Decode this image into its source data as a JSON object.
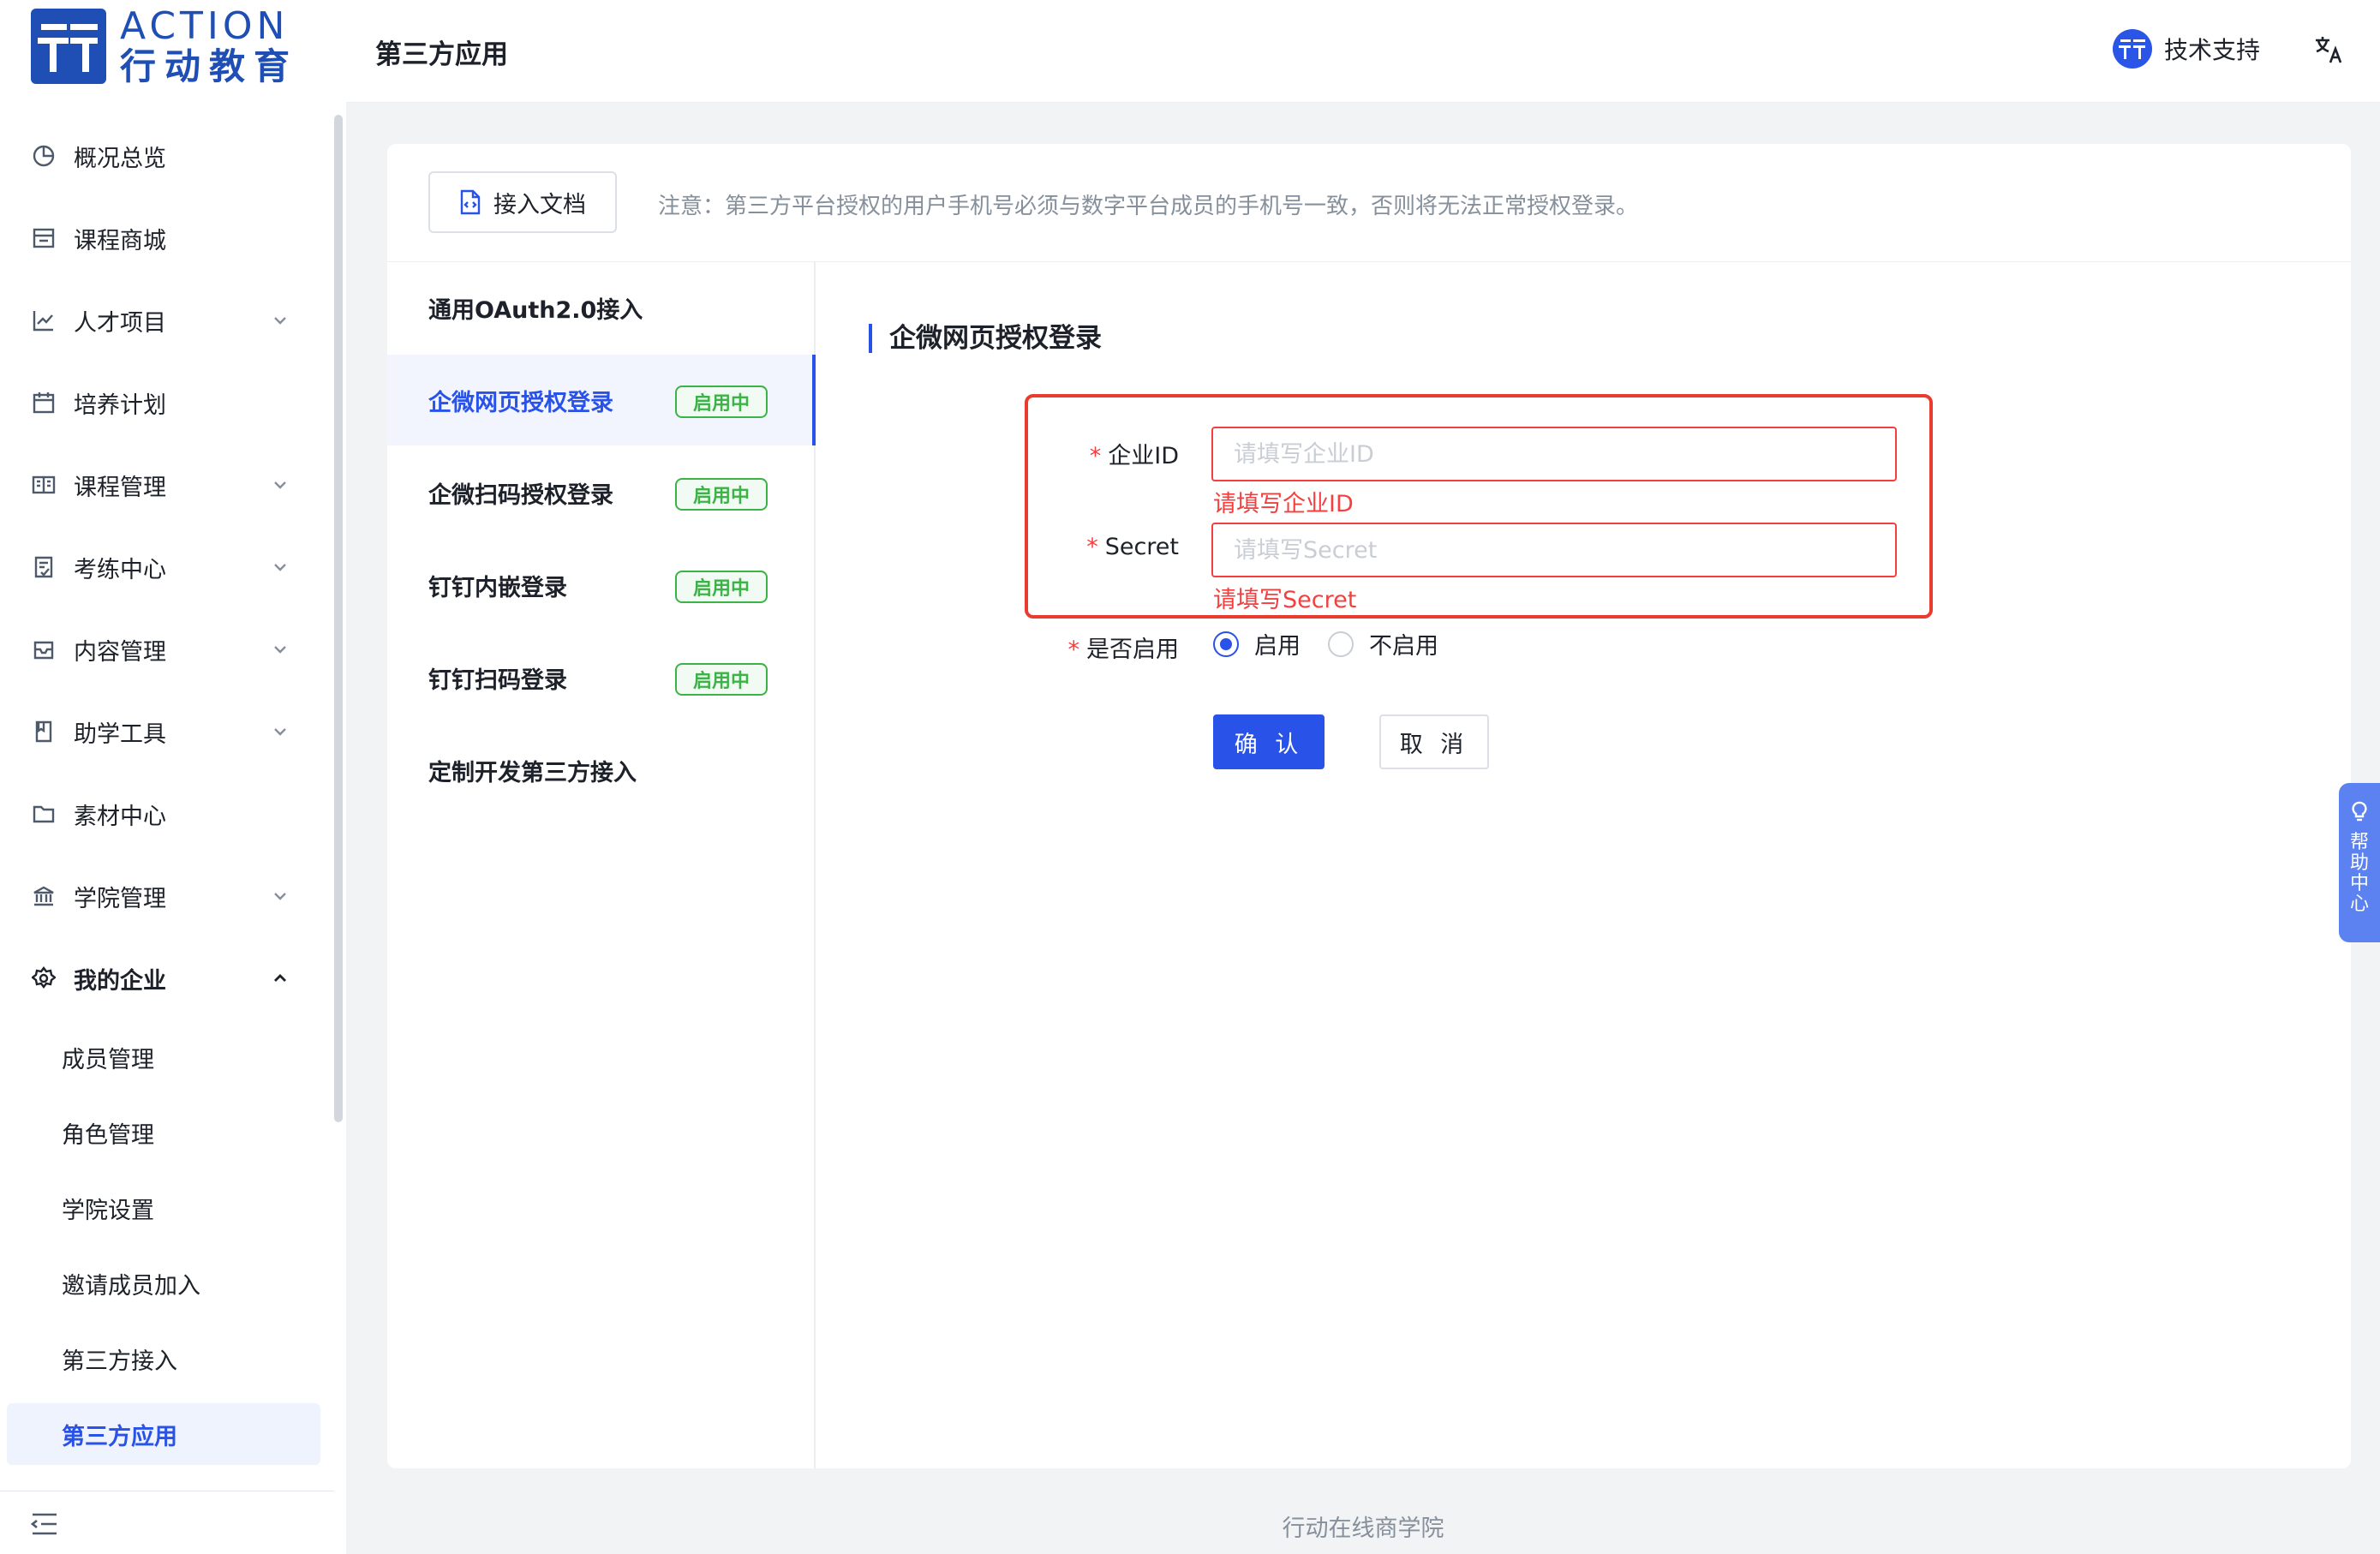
{
  "logo": {
    "en": "ACTION",
    "cn": "行动教育"
  },
  "header": {
    "title": "第三方应用",
    "support_label": "技术支持"
  },
  "sidebar": {
    "items": [
      {
        "label": "概况总览",
        "icon": "pie-chart-icon",
        "expandable": false
      },
      {
        "label": "课程商城",
        "icon": "store-icon",
        "expandable": false
      },
      {
        "label": "人才项目",
        "icon": "line-chart-icon",
        "expandable": true
      },
      {
        "label": "培养计划",
        "icon": "calendar-icon",
        "expandable": false
      },
      {
        "label": "课程管理",
        "icon": "book-open-icon",
        "expandable": true
      },
      {
        "label": "考练中心",
        "icon": "exam-icon",
        "expandable": true
      },
      {
        "label": "内容管理",
        "icon": "inbox-icon",
        "expandable": true
      },
      {
        "label": "助学工具",
        "icon": "bookmark-icon",
        "expandable": true
      },
      {
        "label": "素材中心",
        "icon": "folder-icon",
        "expandable": false
      },
      {
        "label": "学院管理",
        "icon": "bank-icon",
        "expandable": true
      },
      {
        "label": "我的企业",
        "icon": "gear-icon",
        "expandable": true,
        "expanded": true
      }
    ],
    "sub_items": [
      "成员管理",
      "角色管理",
      "学院设置",
      "邀请成员加入",
      "第三方接入",
      "第三方应用"
    ],
    "active_sub": "第三方应用"
  },
  "toolbar": {
    "doc_button": "接入文档",
    "notice": "注意：第三方平台授权的用户手机号必须与数字平台成员的手机号一致，否则将无法正常授权登录。"
  },
  "methods": [
    {
      "label": "通用OAuth2.0接入",
      "badge": ""
    },
    {
      "label": "企微网页授权登录",
      "badge": "启用中",
      "active": true
    },
    {
      "label": "企微扫码授权登录",
      "badge": "启用中"
    },
    {
      "label": "钉钉内嵌登录",
      "badge": "启用中"
    },
    {
      "label": "钉钉扫码登录",
      "badge": "启用中"
    },
    {
      "label": "定制开发第三方接入",
      "badge": ""
    }
  ],
  "form": {
    "section_title": "企微网页授权登录",
    "corp_id": {
      "label": "企业ID",
      "placeholder": "请填写企业ID",
      "value": "",
      "error": "请填写企业ID"
    },
    "secret": {
      "label": "Secret",
      "placeholder": "请填写Secret",
      "value": "",
      "error": "请填写Secret"
    },
    "enable": {
      "label": "是否启用",
      "options": [
        "启用",
        "不启用"
      ],
      "selected": "启用"
    },
    "confirm_label": "确 认",
    "cancel_label": "取 消"
  },
  "footer": {
    "text": "行动在线商学院"
  },
  "help": {
    "label": "帮助中心"
  },
  "colors": {
    "primary": "#2852e8",
    "error": "#f53f3f",
    "success": "#3bb346",
    "highlight": "#e93c2f"
  }
}
